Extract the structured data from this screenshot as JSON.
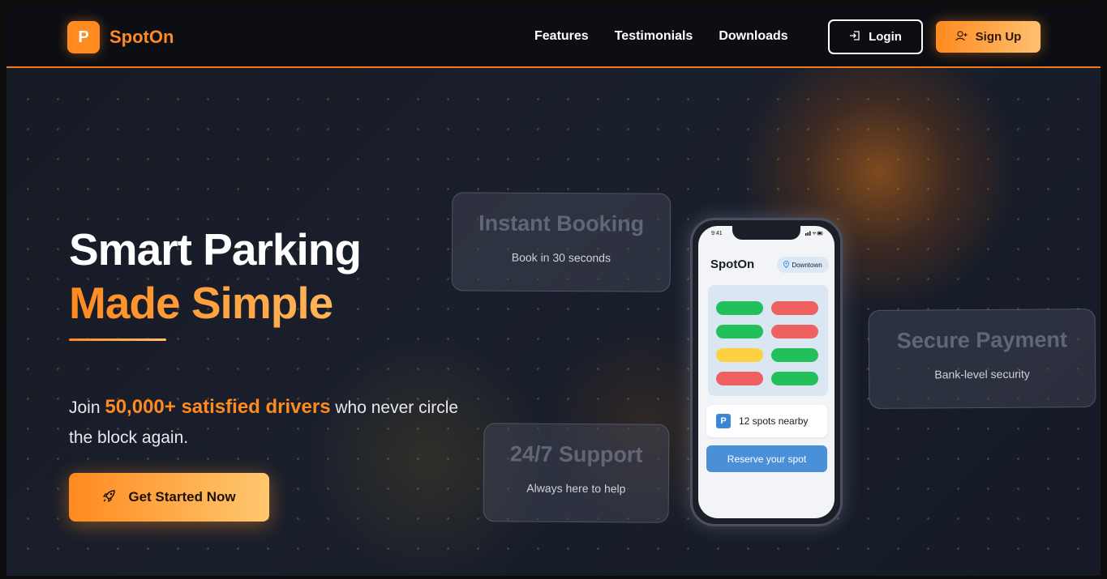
{
  "brand": {
    "logo_letter": "P",
    "name": "SpotOn"
  },
  "nav": {
    "links": [
      "Features",
      "Testimonials",
      "Downloads"
    ],
    "login_label": "Login",
    "signup_label": "Sign Up",
    "login_icon": "login-arrow-icon",
    "signup_icon": "user-plus-icon"
  },
  "hero": {
    "title_line1": "Smart Parking",
    "title_line2": "Made Simple",
    "sub_prefix": "Join ",
    "sub_highlight": "50,000+ satisfied drivers",
    "sub_suffix": " who never circle the block again.",
    "cta_label": "Get Started Now",
    "cta_icon": "rocket-icon"
  },
  "features": [
    {
      "title": "Instant Booking",
      "subtitle": "Book in 30 seconds"
    },
    {
      "title": "Secure Payment",
      "subtitle": "Bank-level security"
    },
    {
      "title": "24/7 Support",
      "subtitle": "Always here to help"
    }
  ],
  "phone": {
    "time": "9:41",
    "status_icons": "signal-wifi-battery-icons",
    "app_title": "SpotOn",
    "location": "Downtown",
    "spots": [
      [
        "available",
        "occupied"
      ],
      [
        "available",
        "occupied"
      ],
      [
        "reserved",
        "available"
      ],
      [
        "occupied",
        "available"
      ]
    ],
    "spots_text": "12 spots nearby",
    "p_badge": "P",
    "reserve_label": "Reserve your spot"
  },
  "colors": {
    "accent": "#ff8a1f",
    "available": "#22c05a",
    "occupied": "#ef6060",
    "reserved": "#fcd040",
    "phone_button": "#4a90d9"
  }
}
